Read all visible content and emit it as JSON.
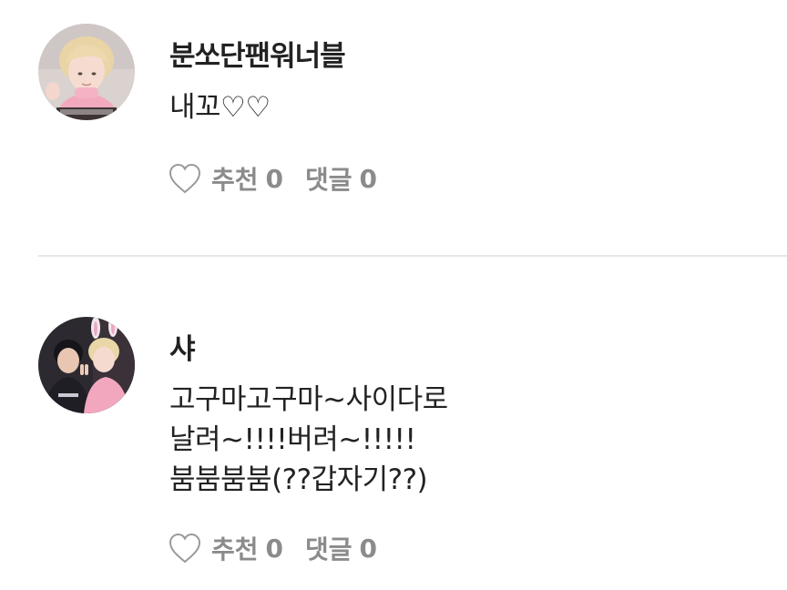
{
  "comments": [
    {
      "username": "분쏘단팬워너블",
      "body_lines": [
        "내꼬♡♡"
      ],
      "like_label": "추천",
      "like_count": "0",
      "reply_label": "댓글",
      "reply_count": "0"
    },
    {
      "username": "샤",
      "body_lines": [
        "고구마고구마~사이다로",
        "날려~!!!!버려~!!!!!",
        "붐붐붐붐(??갑자기??)"
      ],
      "like_label": "추천",
      "like_count": "0",
      "reply_label": "댓글",
      "reply_count": "0"
    }
  ],
  "colors": {
    "text": "#222222",
    "meta": "#8b8b8b",
    "divider": "#e6e6e6"
  },
  "icons": {
    "like": "heart-outline-icon"
  }
}
